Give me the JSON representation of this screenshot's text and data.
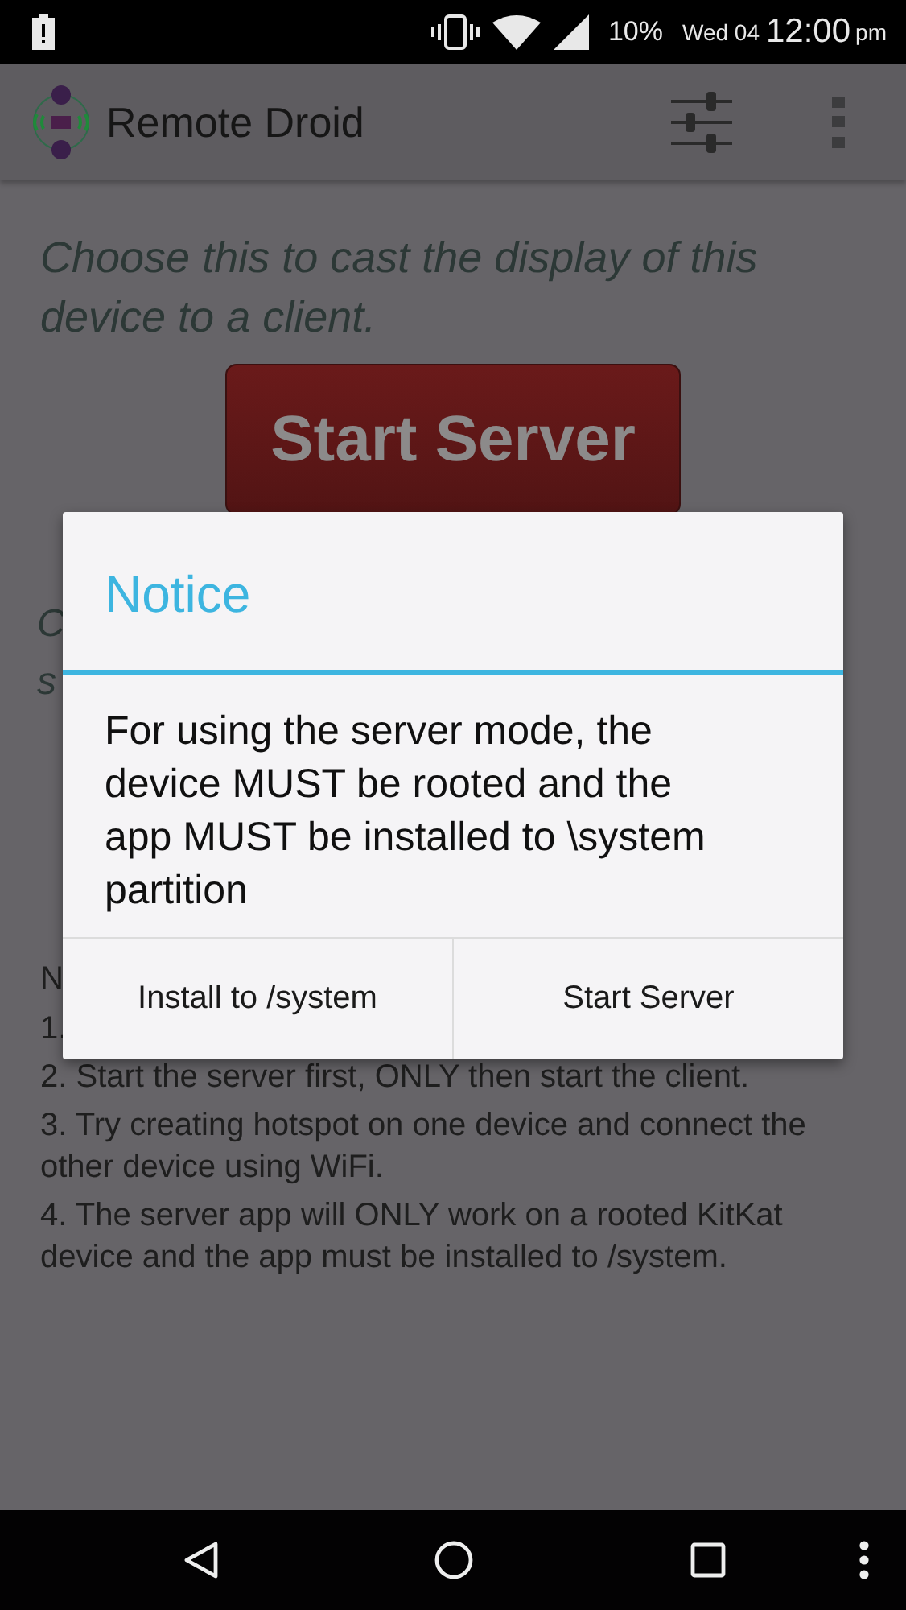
{
  "status_bar": {
    "battery": "10%",
    "date": "Wed 04",
    "time": "12:00",
    "ampm": "pm"
  },
  "app_bar": {
    "title": "Remote Droid"
  },
  "server_section": {
    "description": "Choose this to cast the display of this device to a client.",
    "button": "Start Server"
  },
  "client_section": {
    "fragments": [
      "C",
      "s"
    ]
  },
  "notes": {
    "heading": "N",
    "items": [
      "1.",
      "2. Start the server first, ONLY then start the client.",
      "3. Try creating hotspot on one device and connect the other device using WiFi.",
      "4. The server app will ONLY work on a rooted KitKat device and the app must be installed to /system."
    ]
  },
  "dialog": {
    "title": "Notice",
    "message": "For using the server mode, the device MUST be rooted and the app MUST be installed to \\system partition",
    "buttons": [
      "Install to /system",
      "Start Server"
    ]
  }
}
